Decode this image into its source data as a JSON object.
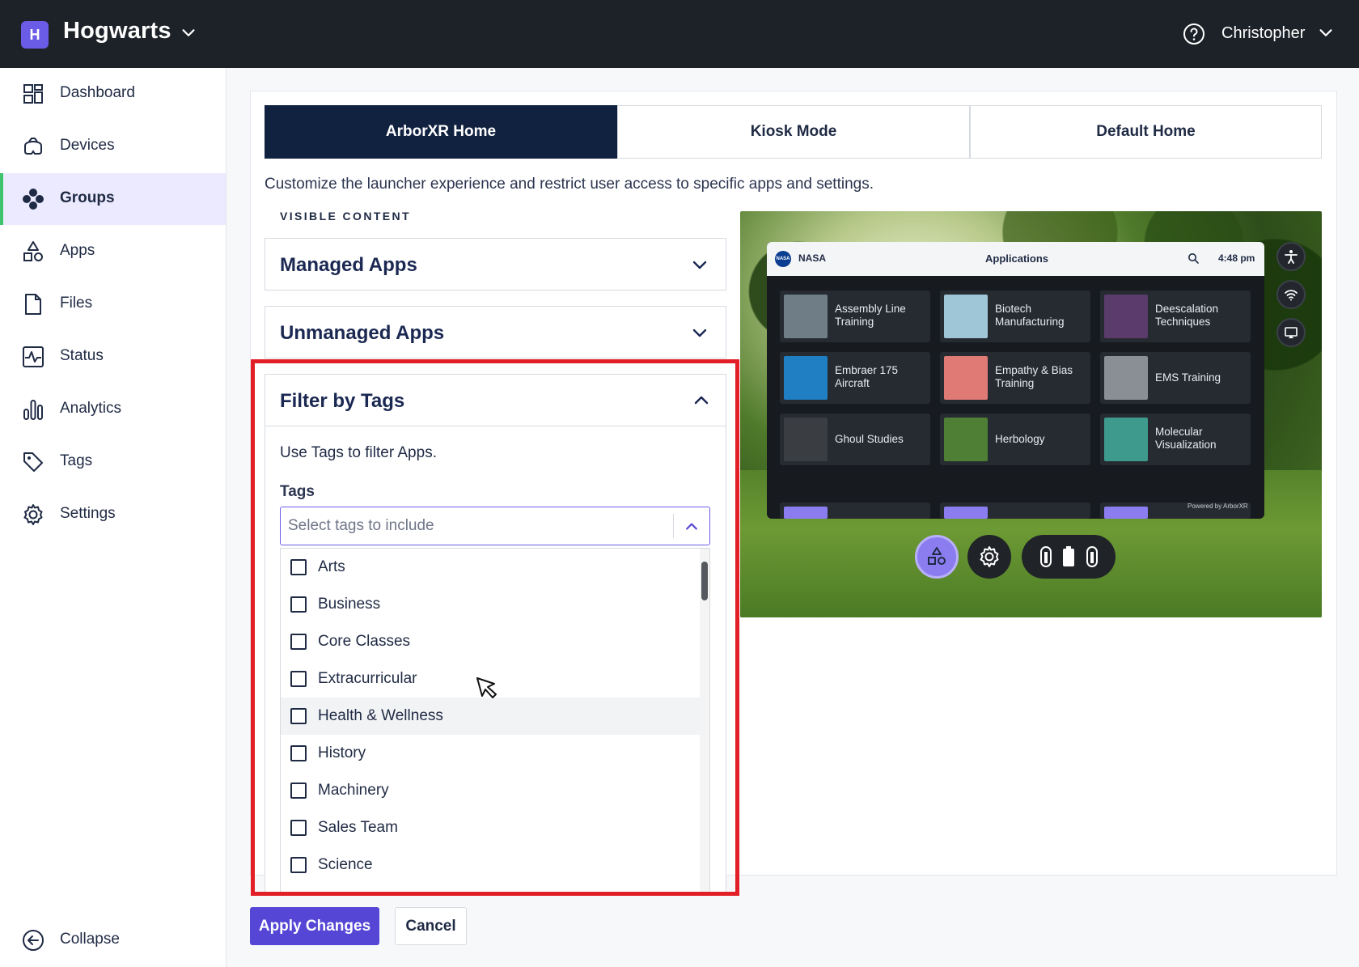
{
  "topbar": {
    "org_initial": "H",
    "org_name": "Hogwarts",
    "user_name": "Christopher"
  },
  "sidebar": {
    "items": [
      {
        "label": "Dashboard",
        "icon": "dashboard-icon"
      },
      {
        "label": "Devices",
        "icon": "headset-icon"
      },
      {
        "label": "Groups",
        "icon": "groups-icon",
        "active": true
      },
      {
        "label": "Apps",
        "icon": "apps-icon"
      },
      {
        "label": "Files",
        "icon": "file-icon"
      },
      {
        "label": "Status",
        "icon": "status-icon"
      },
      {
        "label": "Analytics",
        "icon": "analytics-icon"
      },
      {
        "label": "Tags",
        "icon": "tag-icon"
      },
      {
        "label": "Settings",
        "icon": "gear-icon"
      }
    ],
    "collapse_label": "Collapse"
  },
  "tabs": [
    {
      "label": "ArborXR Home",
      "active": true
    },
    {
      "label": "Kiosk Mode",
      "active": false
    },
    {
      "label": "Default Home",
      "active": false
    }
  ],
  "description": "Customize the launcher experience and restrict user access to specific apps and settings.",
  "visible_content_label": "VISIBLE CONTENT",
  "accordions": {
    "managed_apps": "Managed Apps",
    "unmanaged_apps": "Unmanaged Apps",
    "filter_by_tags": "Filter by Tags"
  },
  "filter": {
    "help_text": "Use Tags to filter Apps.",
    "tags_label": "Tags",
    "select_placeholder": "Select tags to include",
    "options": [
      "Arts",
      "Business",
      "Core Classes",
      "Extracurricular",
      "Health & Wellness",
      "History",
      "Machinery",
      "Sales Team",
      "Science"
    ],
    "hovered_option": "Health & Wellness"
  },
  "preview": {
    "org": "NASA",
    "org_logo_text": "NASA",
    "title": "Applications",
    "time": "4:48 pm",
    "powered_by": "Powered by ArborXR",
    "apps": [
      {
        "name": "Assembly Line Training",
        "thumb_color": "#6f7d86"
      },
      {
        "name": "Biotech Manufacturing",
        "thumb_color": "#9fc6d6"
      },
      {
        "name": "Deescalation Techniques",
        "thumb_color": "#5a3b6b"
      },
      {
        "name": "Embraer 175 Aircraft",
        "thumb_color": "#1f7fc2"
      },
      {
        "name": "Empathy & Bias Training",
        "thumb_color": "#e07a74"
      },
      {
        "name": "EMS Training",
        "thumb_color": "#8a8f95"
      },
      {
        "name": "Ghoul Studies",
        "thumb_color": "#3a3d42"
      },
      {
        "name": "Herbology",
        "thumb_color": "#4e7f35"
      },
      {
        "name": "Molecular Visualization",
        "thumb_color": "#3d9a8c"
      }
    ],
    "accent": "#8b7cf0"
  },
  "buttons": {
    "apply": "Apply Changes",
    "cancel": "Cancel"
  },
  "colors": {
    "topbar_bg": "#1d2228",
    "brand_purple": "#5546d6",
    "active_tab": "#112240",
    "active_nav_bg": "#eceaff",
    "active_nav_marker": "#3ec46d",
    "highlight_frame": "#e21e26"
  }
}
